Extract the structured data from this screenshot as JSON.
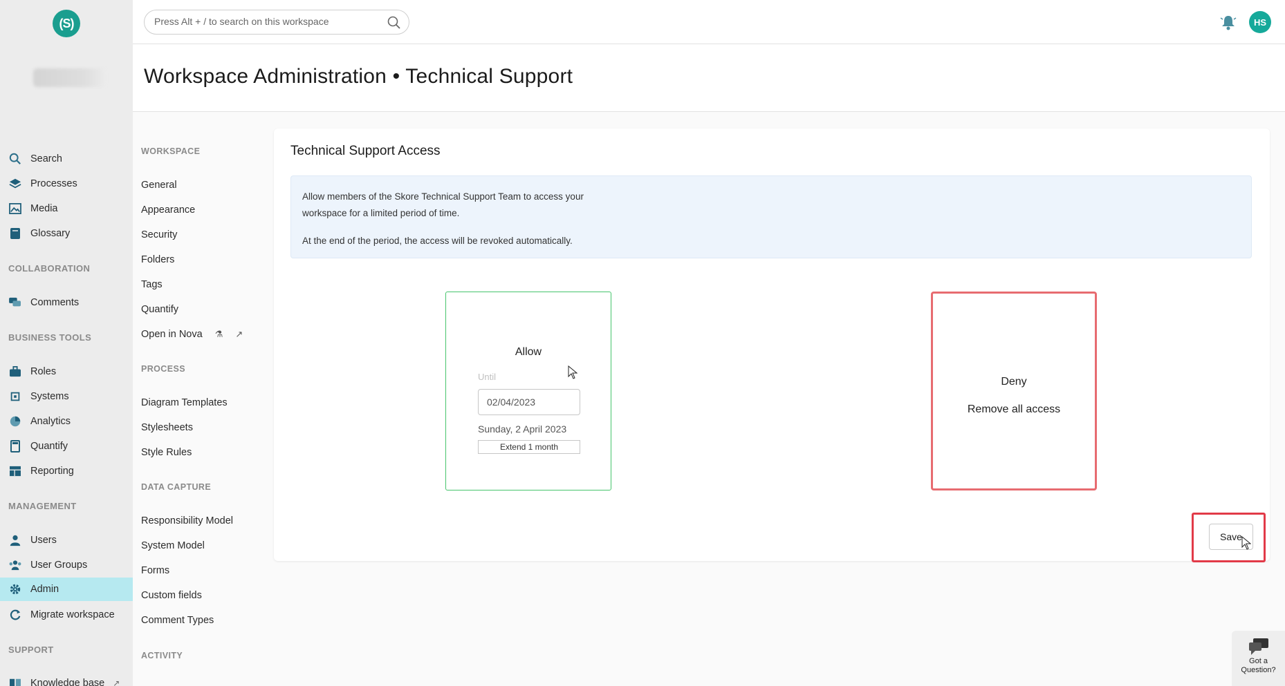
{
  "app": {
    "logo_text": "(S)"
  },
  "nav": {
    "items_top": [
      {
        "label": "Search",
        "icon": "search-icon"
      },
      {
        "label": "Processes",
        "icon": "layers-icon"
      },
      {
        "label": "Media",
        "icon": "image-icon"
      },
      {
        "label": "Glossary",
        "icon": "book-icon"
      }
    ],
    "section_collaboration": "COLLABORATION",
    "items_collaboration": [
      {
        "label": "Comments",
        "icon": "comments-icon"
      }
    ],
    "section_business": "BUSINESS TOOLS",
    "items_business": [
      {
        "label": "Roles",
        "icon": "briefcase-icon"
      },
      {
        "label": "Systems",
        "icon": "chip-icon"
      },
      {
        "label": "Analytics",
        "icon": "pie-chart-icon"
      },
      {
        "label": "Quantify",
        "icon": "calculator-icon"
      },
      {
        "label": "Reporting",
        "icon": "table-icon"
      }
    ],
    "section_management": "MANAGEMENT",
    "items_management": [
      {
        "label": "Users",
        "icon": "user-icon"
      },
      {
        "label": "User Groups",
        "icon": "users-icon"
      },
      {
        "label": "Admin",
        "icon": "gear-icon",
        "active": true
      },
      {
        "label": "Migrate workspace",
        "icon": "refresh-icon"
      }
    ],
    "section_support": "SUPPORT",
    "items_support": [
      {
        "label": "Knowledge base",
        "icon": "book-open-icon"
      }
    ]
  },
  "submenu": {
    "section_workspace": "WORKSPACE",
    "workspace": [
      "General",
      "Appearance",
      "Security",
      "Folders",
      "Tags",
      "Quantify",
      "Open in Nova"
    ],
    "section_process": "PROCESS",
    "process": [
      "Diagram Templates",
      "Stylesheets",
      "Style Rules"
    ],
    "section_data_capture": "DATA CAPTURE",
    "data_capture": [
      "Responsibility Model",
      "System Model",
      "Forms",
      "Custom fields",
      "Comment Types"
    ],
    "section_activity": "ACTIVITY"
  },
  "topbar": {
    "search_placeholder": "Press Alt + / to search on this workspace",
    "avatar_initials": "HS"
  },
  "header": {
    "title": "Workspace Administration • Technical Support"
  },
  "card": {
    "title": "Technical Support Access",
    "info_line1": "Allow members of the Skore Technical Support Team to access your workspace for a limited period of time.",
    "info_line2": "At the end of the period, the access will be revoked automatically.",
    "allow": {
      "label": "Allow",
      "until_label": "Until",
      "date_value": "02/04/2023",
      "date_text": "Sunday, 2 April 2023",
      "extend_label": "Extend 1 month"
    },
    "deny": {
      "label": "Deny",
      "sub_label": "Remove all access"
    },
    "save_label": "Save"
  },
  "help": {
    "line1": "Got a",
    "line2": "Question?"
  },
  "colors": {
    "accent": "#16a99a",
    "active_nav": "#b6e9f0",
    "allow_border": "#45c46b",
    "deny_border": "#e76b70",
    "highlight": "#e23a48",
    "info_bg": "#edf4fc"
  }
}
